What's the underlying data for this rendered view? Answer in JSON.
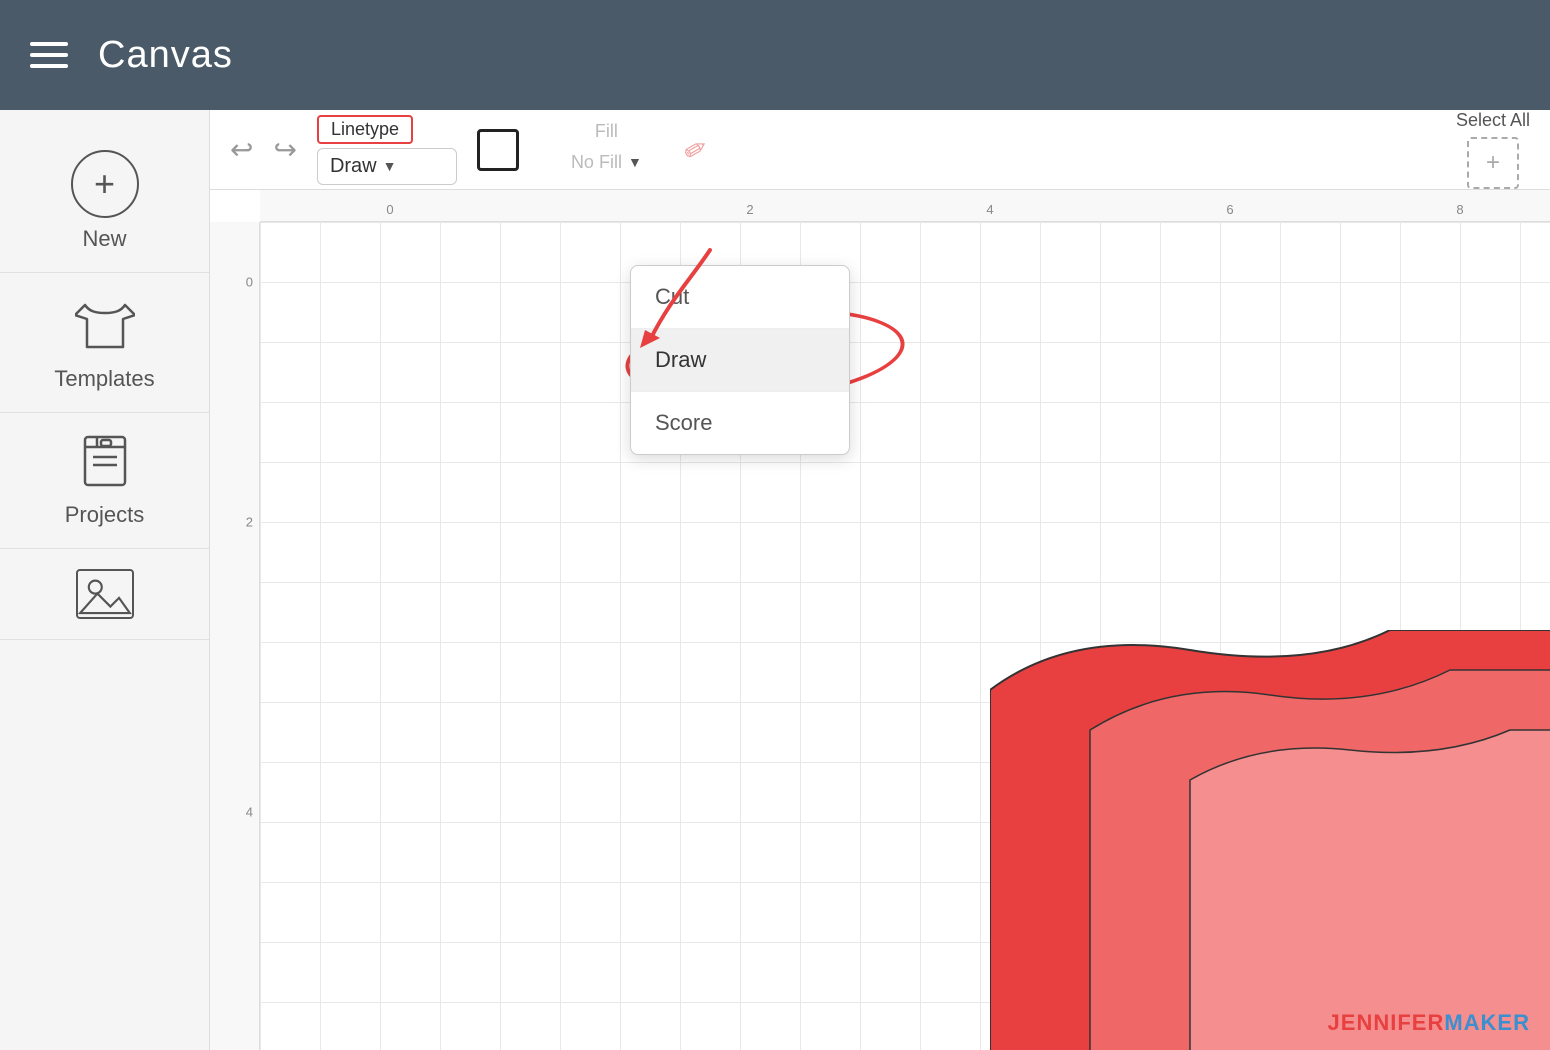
{
  "header": {
    "title": "Canvas",
    "menu_icon": "hamburger-icon"
  },
  "sidebar": {
    "items": [
      {
        "id": "new",
        "label": "New",
        "icon": "plus-circle-icon"
      },
      {
        "id": "templates",
        "label": "Templates",
        "icon": "tshirt-icon"
      },
      {
        "id": "projects",
        "label": "Projects",
        "icon": "notebook-icon"
      },
      {
        "id": "images",
        "label": "",
        "icon": "images-icon"
      }
    ]
  },
  "toolbar": {
    "undo_label": "↩",
    "redo_label": "↪",
    "linetype_label": "Linetype",
    "linetype_value": "Draw",
    "fill_label": "Fill",
    "fill_value": "No Fill",
    "select_all_label": "Select All",
    "select_all_icon": "+"
  },
  "linetype_menu": {
    "items": [
      {
        "id": "cut",
        "label": "Cut",
        "selected": false
      },
      {
        "id": "draw",
        "label": "Draw",
        "selected": true
      },
      {
        "id": "score",
        "label": "Score",
        "selected": false
      }
    ]
  },
  "ruler": {
    "horizontal": [
      "0",
      "2",
      "4",
      "6",
      "8"
    ],
    "vertical": [
      "0",
      "2",
      "4"
    ]
  },
  "watermark": {
    "part1": "JENNIFER",
    "part2": "MAKER"
  }
}
